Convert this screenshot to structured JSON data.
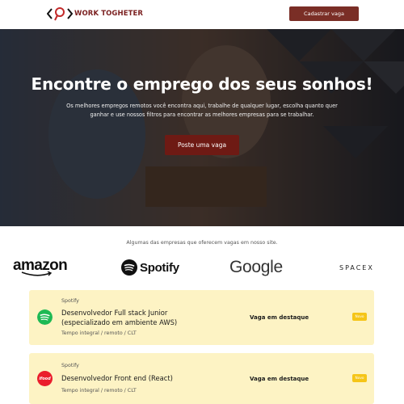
{
  "header": {
    "logo_text": "WORK TOGHETER",
    "cta_label": "Cadastrar vaga"
  },
  "hero": {
    "title": "Encontre o emprego dos seus sonhos!",
    "subtitle": "Os melhores empregos remotos você encontra aqui, trabalhe de qualquer lugar, escolha quanto quer ganhar e use nossos filtros para encontrar as melhores empresas para se trabalhar.",
    "button_label": "Poste uma vaga"
  },
  "companies": {
    "caption": "Algumas das empresas que oferecem vagas em nosso site.",
    "logos": [
      "amazon",
      "Spotify",
      "Google",
      "SPACEX"
    ]
  },
  "jobs": [
    {
      "company": "Spotify",
      "title": "Desenvolvedor Full stack Junior (especializado em ambiente AWS)",
      "meta": "Tempo integral / remoto / CLT",
      "feature": "Vaga em destaque",
      "badge": "Novo",
      "logo_color": "#1db954"
    },
    {
      "company": "Spotify",
      "title": "Desenvolvedor Front end (React)",
      "meta": "Tempo integral / remoto / CLT",
      "feature": "Vaga em destaque",
      "badge": "Novo",
      "logo_color": "#ea1d2c",
      "logo_text": "ifood"
    }
  ],
  "colors": {
    "brand": "#7a2e26",
    "card_bg": "#fdf3c4",
    "badge": "#f5c518"
  }
}
